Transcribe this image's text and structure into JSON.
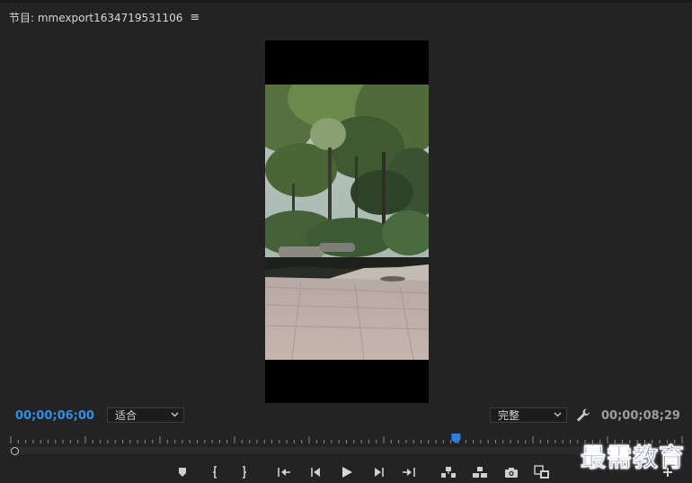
{
  "header": {
    "title": "节目: mmexport1634719531106",
    "menu_icon": "≡"
  },
  "playhead_timecode": "00;00;06;00",
  "duration_timecode": "00;00;08;29",
  "zoom": {
    "selected": "适合"
  },
  "quality": {
    "selected": "完整"
  },
  "playhead_position_fraction": 0.665,
  "transport_icons": [
    "marker-icon",
    "mark-in-icon",
    "mark-out-icon",
    "go-to-in-icon",
    "step-back-icon",
    "play-icon",
    "step-forward-icon",
    "go-to-out-icon",
    "lift-icon",
    "extract-icon",
    "export-frame-icon",
    "comparison-view-icon",
    "add-button-icon"
  ],
  "watermark": "最需教育",
  "colors": {
    "background": "#232323",
    "timecode_active": "#2f8fe8",
    "playhead": "#2e7fe0"
  }
}
